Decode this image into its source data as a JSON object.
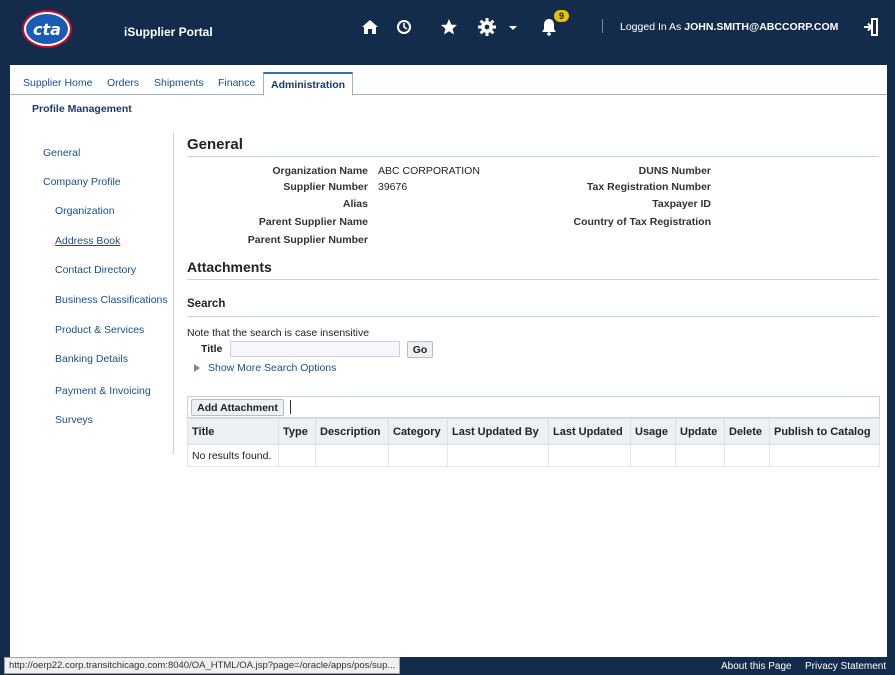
{
  "header": {
    "logo_text": "cta",
    "portal_title": "iSupplier Portal",
    "notification_count": "9",
    "logged_in_prefix": "Logged In As",
    "user": "JOHN.SMITH@ABCCORP.COM",
    "icons": [
      "home-icon",
      "clock-icon",
      "star-icon",
      "gear-icon",
      "bell-icon",
      "logout-icon"
    ]
  },
  "tabs": [
    {
      "label": "Supplier Home",
      "active": false
    },
    {
      "label": "Orders",
      "active": false
    },
    {
      "label": "Shipments",
      "active": false
    },
    {
      "label": "Finance",
      "active": false
    },
    {
      "label": "Administration",
      "active": true
    }
  ],
  "subtab": "Profile Management",
  "left_nav": [
    {
      "label": "General"
    },
    {
      "label": "Company Profile"
    },
    {
      "label": "Organization"
    },
    {
      "label": "Address Book"
    },
    {
      "label": "Contact Directory"
    },
    {
      "label": "Business Classifications"
    },
    {
      "label": "Product & Services"
    },
    {
      "label": "Banking Details"
    },
    {
      "label": "Payment & Invoicing"
    },
    {
      "label": "Surveys"
    }
  ],
  "general": {
    "heading": "General",
    "left_fields": [
      {
        "label": "Organization Name",
        "value": "ABC CORPORATION"
      },
      {
        "label": "Supplier Number",
        "value": "39676"
      },
      {
        "label": "Alias",
        "value": ""
      },
      {
        "label": "Parent Supplier Name",
        "value": ""
      },
      {
        "label": "Parent Supplier Number",
        "value": ""
      }
    ],
    "right_fields": [
      {
        "label": "DUNS Number",
        "value": ""
      },
      {
        "label": "Tax Registration Number",
        "value": ""
      },
      {
        "label": "Taxpayer ID",
        "value": ""
      },
      {
        "label": "Country of Tax Registration",
        "value": ""
      }
    ]
  },
  "attachments": {
    "heading": "Attachments",
    "search_heading": "Search",
    "note": "Note that the search is case insensitive",
    "title_label": "Title",
    "title_value": "",
    "go_label": "Go",
    "more_options": "Show More Search Options",
    "add_label": "Add Attachment",
    "columns": [
      "Title",
      "Type",
      "Description",
      "Category",
      "Last Updated By",
      "Last Updated",
      "Usage",
      "Update",
      "Delete",
      "Publish to Catalog"
    ],
    "empty_text": "No results found."
  },
  "statusbar": {
    "url": "http://oerp22.corp.transitchicago.com:8040/OA_HTML/OA.jsp?page=/oracle/apps/pos/sup...",
    "about": "About this Page",
    "privacy": "Privacy Statement"
  }
}
